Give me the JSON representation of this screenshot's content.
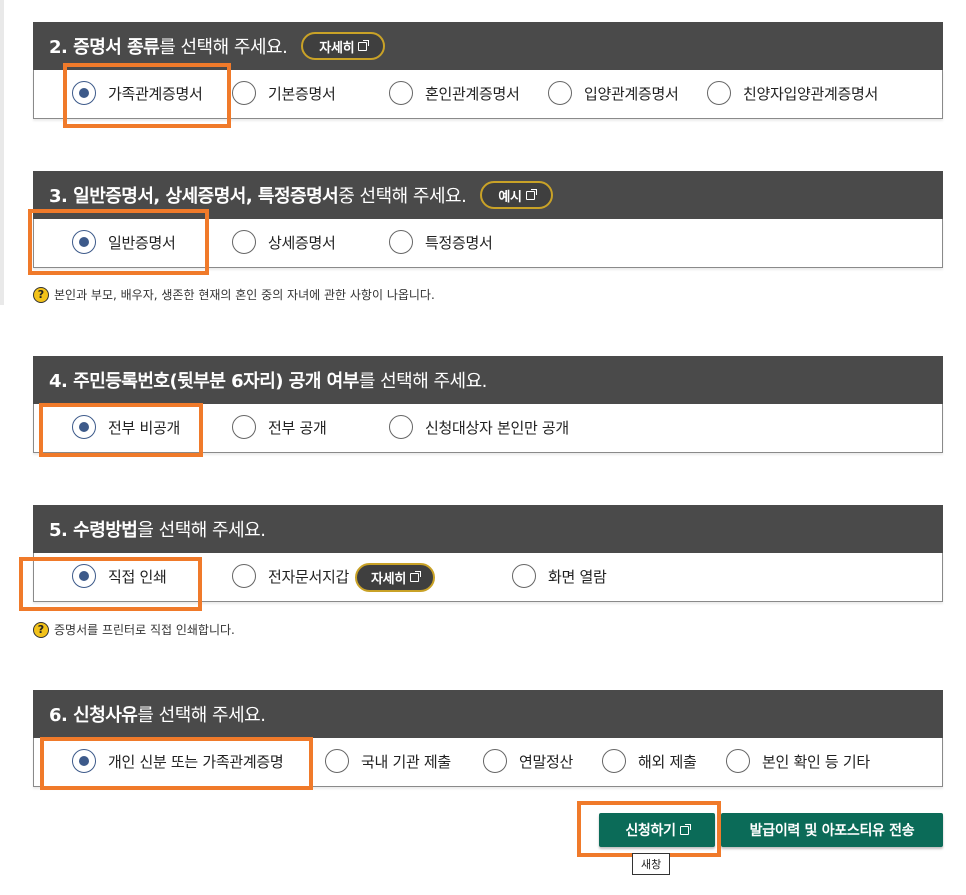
{
  "sections": [
    {
      "head_bold": "2. 증명서 종류",
      "head_rest": "를 선택해 주세요.",
      "pill": "자세히",
      "options": [
        "가족관계증명서",
        "기본증명서",
        "혼인관계증명서",
        "입양관계증명서",
        "친양자입양관계증명서"
      ],
      "selected": 0
    },
    {
      "head_bold": "3. 일반증명서, 상세증명서, 특정증명서",
      "head_rest": " 중 선택해 주세요.",
      "pill": "예시",
      "options": [
        "일반증명서",
        "상세증명서",
        "특정증명서"
      ],
      "selected": 0,
      "note": "본인과 부모, 배우자, 생존한 현재의 혼인 중의 자녀에 관한 사항이 나옵니다."
    },
    {
      "head_bold": "4. 주민등록번호(뒷부분 6자리) 공개 여부",
      "head_rest": "를 선택해 주세요.",
      "options": [
        "전부 비공개",
        "전부 공개",
        "신청대상자 본인만 공개"
      ],
      "selected": 0
    },
    {
      "head_bold": "5. 수령방법",
      "head_rest": "을 선택해 주세요.",
      "options": [
        "직접 인쇄",
        "전자문서지갑",
        "화면 열람"
      ],
      "inline_pill": "자세히",
      "selected": 0,
      "note": "증명서를 프린터로 직접 인쇄합니다."
    },
    {
      "head_bold": "6. 신청사유",
      "head_rest": "를 선택해 주세요.",
      "options": [
        "개인 신분 또는 가족관계증명",
        "국내 기관 제출",
        "연말정산",
        "해외 제출",
        "본인 확인 등 기타"
      ],
      "selected": 0
    }
  ],
  "note_icon": "?",
  "buttons": {
    "apply": "신청하기",
    "history": "발급이력 및 아포스티유 전송",
    "tooltip": "새창"
  },
  "colors": {
    "header_bg": "#4a4a4a",
    "radio_selected": "#3d5a8a",
    "highlight": "#f07a2a",
    "pill_border": "#c9a227",
    "button_green": "#0b6b58",
    "note_icon": "#f2c21a"
  }
}
